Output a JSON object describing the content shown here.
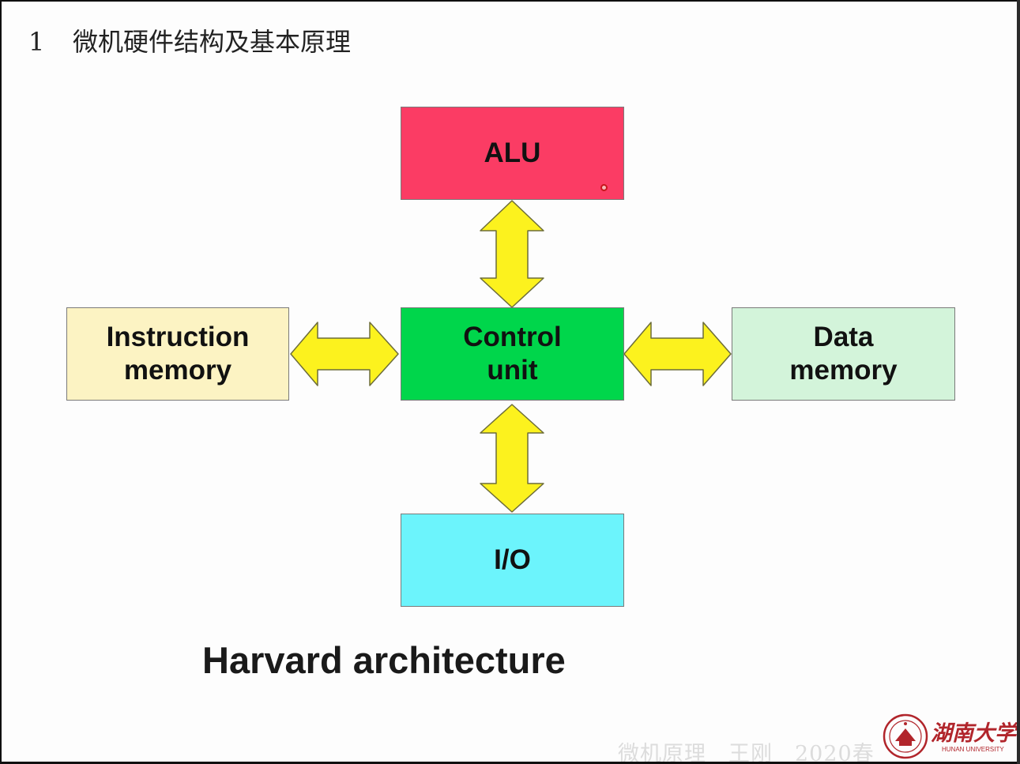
{
  "slide": {
    "heading_number": "1",
    "heading_text": "微机硬件结构及基本原理",
    "caption": "Harvard architecture",
    "watermark": "微机原理　王刚　2020春",
    "logo_name": "湖南大学",
    "logo_subtitle": "HUNAN UNIVERSITY"
  },
  "diagram": {
    "boxes": [
      {
        "id": "alu",
        "label": "ALU",
        "color": "#fb3c64"
      },
      {
        "id": "control",
        "label": "Control\nunit",
        "color": "#00d64b"
      },
      {
        "id": "io",
        "label": "I/O",
        "color": "#6cf4fc"
      },
      {
        "id": "instruction_memory",
        "label": "Instruction\nmemory",
        "color": "#fcf3c3"
      },
      {
        "id": "data_memory",
        "label": "Data\nmemory",
        "color": "#d3f4da"
      }
    ],
    "connections": [
      {
        "from": "control",
        "to": "alu",
        "type": "bidirectional"
      },
      {
        "from": "control",
        "to": "io",
        "type": "bidirectional"
      },
      {
        "from": "control",
        "to": "instruction_memory",
        "type": "bidirectional"
      },
      {
        "from": "control",
        "to": "data_memory",
        "type": "bidirectional"
      }
    ],
    "arrow_color": "#fcf21e",
    "arrow_stroke": "#6d6d3a"
  },
  "colors": {
    "background": "#fdfdfd",
    "text": "#111111",
    "logo_red": "#b1252b"
  }
}
